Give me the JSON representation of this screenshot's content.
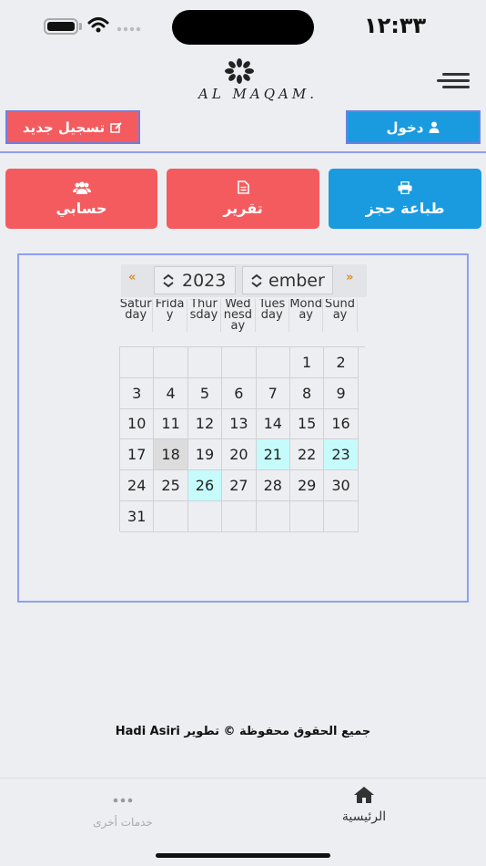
{
  "status_bar": {
    "time": "١٢:٣٣"
  },
  "header": {
    "logo_text": "AL MAQAM.",
    "register_label": "تسجيل جديد",
    "login_label": "دخول"
  },
  "actions": {
    "account_label": "حسابي",
    "report_label": "تقرير",
    "print_label": "طباعة حجز"
  },
  "calendar": {
    "nav_prev": "«",
    "nav_next": "»",
    "year": "2023",
    "month": "ember",
    "weekdays": [
      "Saturday",
      "Friday",
      "Thursday",
      "Wednesday",
      "Tuesday",
      "Monday",
      "Sunday"
    ],
    "highlight_color": "#c6fbfb",
    "rows": [
      [
        "",
        "",
        "",
        "",
        "",
        "1",
        "2"
      ],
      [
        "3",
        "4",
        "5",
        "6",
        "7",
        "8",
        "9"
      ],
      [
        "10",
        "11",
        "12",
        "13",
        "14",
        "15",
        "16"
      ],
      [
        "17",
        "18",
        "19",
        "20",
        "21",
        "22",
        "23"
      ],
      [
        "24",
        "25",
        "26",
        "27",
        "28",
        "29",
        "30"
      ],
      [
        "31",
        "",
        "",
        "",
        "",
        "",
        ""
      ]
    ],
    "highlighted_days": [
      "21",
      "23",
      "26"
    ],
    "today": "18"
  },
  "footer": {
    "copyright": "جميع الحقوق محفوظة © تطوير Hadi Asiri"
  },
  "tabbar": {
    "home_label": "الرئيسية",
    "other_label": "خدمات أخرى"
  },
  "colors": {
    "red": "#f45b5f",
    "blue": "#1a9be0",
    "accent_border": "#8f9ff0"
  }
}
